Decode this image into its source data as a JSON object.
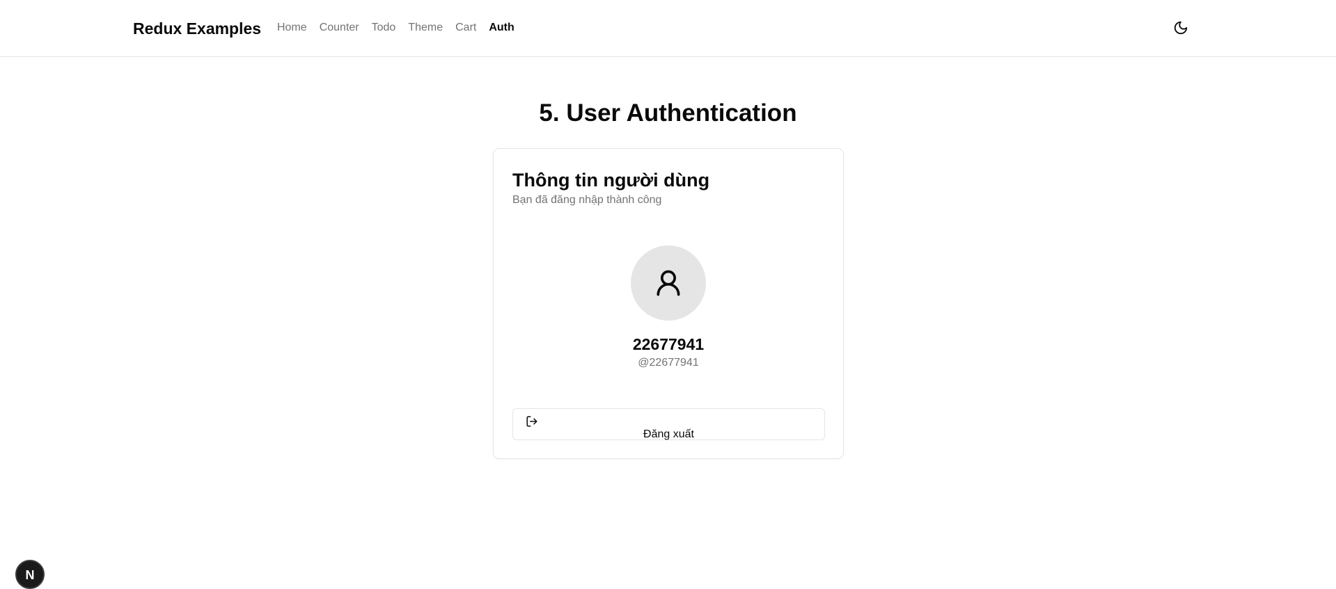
{
  "header": {
    "brand": "Redux Examples",
    "nav": [
      {
        "label": "Home",
        "active": false
      },
      {
        "label": "Counter",
        "active": false
      },
      {
        "label": "Todo",
        "active": false
      },
      {
        "label": "Theme",
        "active": false
      },
      {
        "label": "Cart",
        "active": false
      },
      {
        "label": "Auth",
        "active": true
      }
    ],
    "theme_toggle_icon": "moon-icon"
  },
  "main": {
    "title": "5. User Authentication",
    "card": {
      "title": "Thông tin người dùng",
      "description": "Bạn đã đăng nhập thành công",
      "avatar_icon": "user-icon",
      "user_name": "22677941",
      "user_handle": "@22677941",
      "logout_label": "Đăng xuất",
      "logout_icon": "log-out-icon"
    }
  },
  "devtools": {
    "label": "N",
    "icon": "nextjs-icon"
  },
  "colors": {
    "text": "#0a0a0a",
    "muted": "#737373",
    "border": "#e5e5e5",
    "avatar_bg": "#e5e5e5"
  }
}
